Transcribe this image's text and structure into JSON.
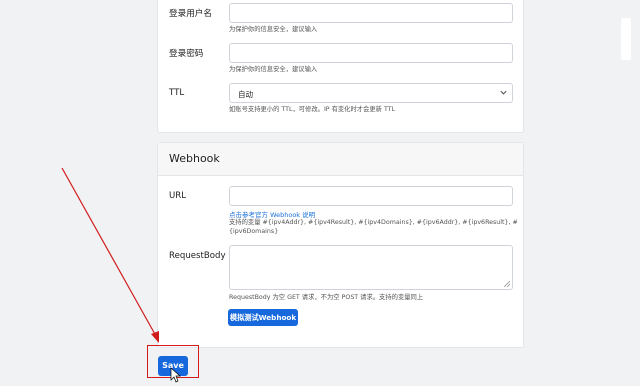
{
  "form": {
    "username_label": "登录用户名",
    "username_hint": "为保护你的信息安全，建议输入",
    "password_label": "登录密码",
    "password_hint": "为保护你的信息安全，建议输入",
    "ttl_label": "TTL",
    "ttl_value": "自动",
    "ttl_hint": "如账号支持更小的 TTL，可修改。IP 有变化时才会更新 TTL"
  },
  "webhook": {
    "title": "Webhook",
    "url_label": "URL",
    "url_doc_link": "点击参考官方 Webhook 说明",
    "variables_hint_line1": "支持的变量 #{ipv4Addr}, #{ipv4Result}, #{ipv4Domains}, #{ipv6Addr}, #{ipv6Result}, #",
    "variables_hint_line2": "{ipv6Domains}",
    "request_body_label": "RequestBody",
    "request_body_hint": "RequestBody 为空 GET 请求，不为空 POST 请求。支持的变量同上",
    "test_button": "模拟测试Webhook"
  },
  "actions": {
    "save_button": "Save"
  },
  "annotation": {
    "color": "#d11a1a"
  },
  "colors": {
    "primary": "#1668dc",
    "link": "#1a6fd6",
    "background": "#f1f2f4"
  }
}
